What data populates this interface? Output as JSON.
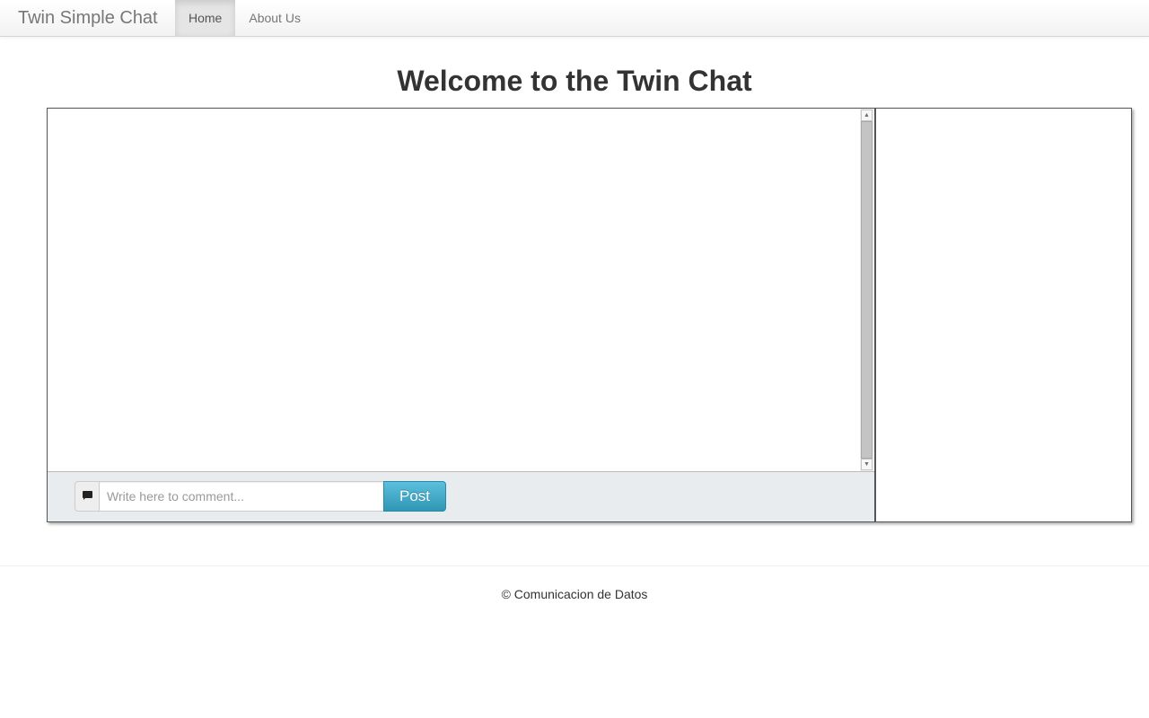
{
  "navbar": {
    "brand": "Twin Simple Chat",
    "items": [
      {
        "label": "Home",
        "active": true
      },
      {
        "label": "About Us",
        "active": false
      }
    ]
  },
  "main": {
    "title": "Welcome to the Twin Chat"
  },
  "chat": {
    "messages": [],
    "scroll_up_icon": "▲",
    "scroll_down_icon": "▼",
    "comment_icon": "comment-icon",
    "input_value": "",
    "input_placeholder": "Write here to comment...",
    "post_label": "Post"
  },
  "users": {
    "items": []
  },
  "footer": {
    "text": "© Comunicacion de Datos"
  },
  "colors": {
    "post_button": "#49afcd",
    "navbar_active": "#e5e5e5",
    "composer_bg": "#e8ecef"
  }
}
